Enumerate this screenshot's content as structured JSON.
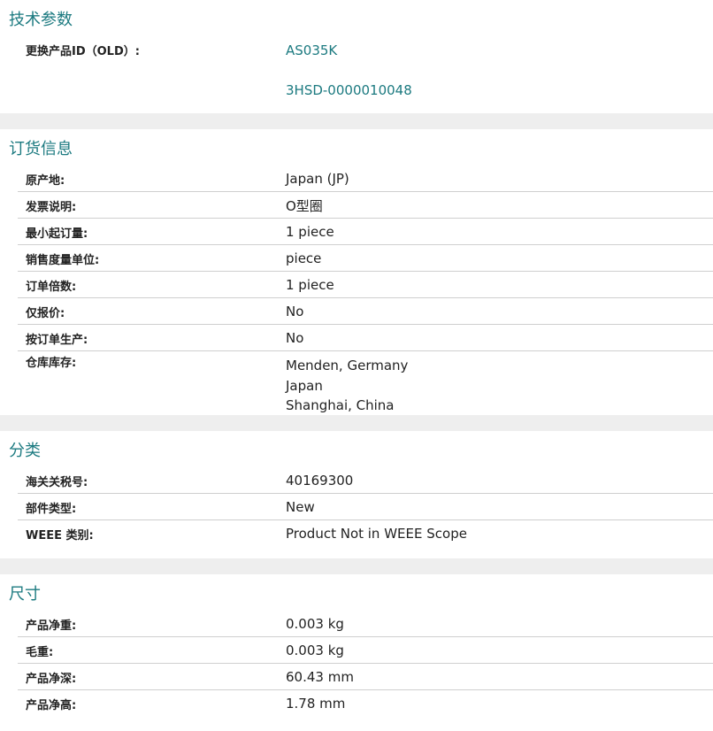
{
  "tech": {
    "title": "技术参数",
    "rows": [
      {
        "label": "更换产品ID（OLD）:",
        "values": [
          "AS035K",
          "3HSD-0000010048"
        ]
      }
    ]
  },
  "order": {
    "title": "订货信息",
    "rows": [
      {
        "label": "原产地:",
        "value": "Japan (JP)"
      },
      {
        "label": "发票说明:",
        "value": "O型圈"
      },
      {
        "label": "最小起订量:",
        "value": "1 piece"
      },
      {
        "label": "销售度量单位:",
        "value": "piece"
      },
      {
        "label": "订单倍数:",
        "value": "1 piece"
      },
      {
        "label": "仅报价:",
        "value": "No"
      },
      {
        "label": "按订单生产:",
        "value": "No"
      },
      {
        "label": "仓库库存:",
        "values": [
          "Menden, Germany",
          "Japan",
          "Shanghai, China"
        ]
      }
    ]
  },
  "classification": {
    "title": "分类",
    "rows": [
      {
        "label": "海关关税号:",
        "value": "40169300"
      },
      {
        "label": "部件类型:",
        "value": "New"
      },
      {
        "label": "WEEE 类别:",
        "value": "Product Not in WEEE Scope"
      }
    ]
  },
  "dimensions": {
    "title": "尺寸",
    "rows": [
      {
        "label": "产品净重:",
        "value": "0.003 kg"
      },
      {
        "label": "毛重:",
        "value": "0.003 kg"
      },
      {
        "label": "产品净深:",
        "value": "60.43 mm"
      },
      {
        "label": "产品净高:",
        "value": "1.78 mm"
      }
    ]
  },
  "colors": {
    "accent": "#1c7a80",
    "divider": "#cfcfcf",
    "section_gap": "#eeeeee"
  }
}
